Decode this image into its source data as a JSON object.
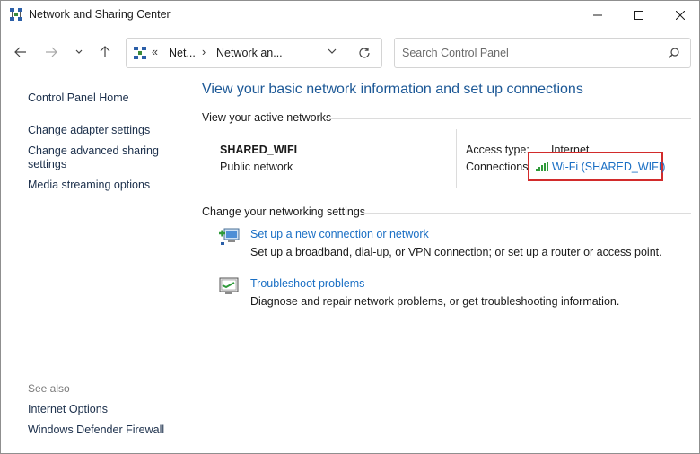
{
  "window": {
    "title": "Network and Sharing Center"
  },
  "nav": {
    "back_icon": "arrow-left-icon",
    "forward_icon": "arrow-right-icon",
    "recent_icon": "chevron-down-icon",
    "up_icon": "arrow-up-icon"
  },
  "address": {
    "overflow": "«",
    "crumbs": [
      "Net...",
      "Network an..."
    ],
    "separator": "›"
  },
  "search": {
    "placeholder": "Search Control Panel"
  },
  "sidebar": {
    "home": "Control Panel Home",
    "links": [
      "Change adapter settings",
      "Change advanced sharing settings",
      "Media streaming options"
    ],
    "see_also_label": "See also",
    "see_also": [
      "Internet Options",
      "Windows Defender Firewall"
    ]
  },
  "main": {
    "heading": "View your basic network information and set up connections",
    "active_label": "View your active networks",
    "network": {
      "name": "SHARED_WIFI",
      "type": "Public network",
      "access_type_label": "Access type:",
      "access_type_value": "Internet",
      "connections_label": "Connections:",
      "connection_link": "Wi-Fi (SHARED_WIFI)"
    },
    "change_label": "Change your networking settings",
    "tasks": [
      {
        "link": "Set up a new connection or network",
        "desc": "Set up a broadband, dial-up, or VPN connection; or set up a router or access point."
      },
      {
        "link": "Troubleshoot problems",
        "desc": "Diagnose and repair network problems, or get troubleshooting information."
      }
    ]
  },
  "colors": {
    "link": "#1a6fc4",
    "heading": "#1c5896",
    "highlight": "#d22b2b"
  }
}
